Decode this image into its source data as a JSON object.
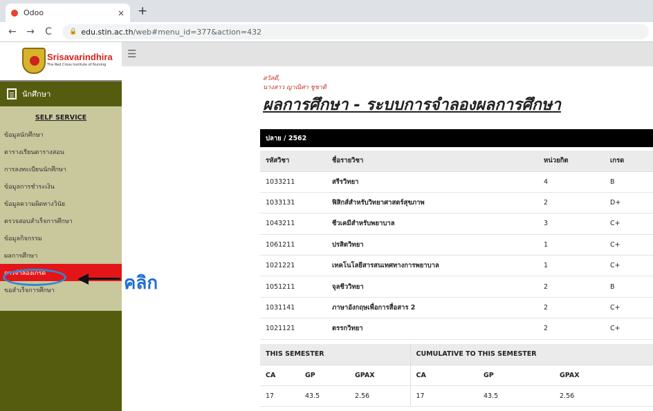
{
  "browser": {
    "tab_title": "Odoo",
    "tab_close": "×",
    "new_tab": "+",
    "nav_back": "←",
    "nav_forward": "→",
    "nav_reload": "C",
    "url_domain": "edu.stin.ac.th",
    "url_path": "/web#menu_id=377&action=432"
  },
  "sidebar": {
    "brand_name": "Srisavarindhira",
    "brand_tagline": "The Red Cross Institute of Nursing",
    "student_menu_label": "นักศึกษา",
    "self_service_heading": "SELF SERVICE",
    "items": [
      {
        "label": "ข้อมูลนักศึกษา"
      },
      {
        "label": "ตารางเรียนตารางสอน"
      },
      {
        "label": "การลงทะเบียนนักศึกษา"
      },
      {
        "label": "ข้อมูลการชำระเงิน"
      },
      {
        "label": "ข้อมูลความผิดทางวินัย"
      },
      {
        "label": "ตรวจสอบสำเร็จการศึกษา"
      },
      {
        "label": "ข้อมูลกิจกรรม"
      },
      {
        "label": "ผลการศึกษา"
      },
      {
        "label": "การจำลองเกรด"
      },
      {
        "label": "ขอสำเร็จการศึกษา"
      }
    ]
  },
  "annotation": {
    "click_label": "คลิก",
    "highlight_color": "#2b8bd6"
  },
  "topbar": {
    "menu_icon": "☰"
  },
  "main": {
    "greeting": "สวัสดี,",
    "user_name": "นางสาว ญาณิศา ชูชาติ",
    "title": "ผลการศึกษา - ระบบการจำลองผลการศึกษา",
    "semester": "ปลาย / 2562",
    "columns": [
      "รหัสวิชา",
      "ชื่อรายวิชา",
      "หน่วยกิต",
      "เกรด"
    ],
    "rows": [
      {
        "code": "1033211",
        "name": "สรีรวิทยา",
        "credit": "4",
        "grade": "B"
      },
      {
        "code": "1033131",
        "name": "ฟิสิกส์สำหรับวิทยาศาสตร์สุขภาพ",
        "credit": "2",
        "grade": "D+"
      },
      {
        "code": "1043211",
        "name": "ชีวเคมีสำหรับพยาบาล",
        "credit": "3",
        "grade": "C+"
      },
      {
        "code": "1061211",
        "name": "ปรสิตวิทยา",
        "credit": "1",
        "grade": "C+"
      },
      {
        "code": "1021221",
        "name": "เทคโนโลยีสารสนเทศทางการพยาบาล",
        "credit": "1",
        "grade": "C+"
      },
      {
        "code": "1051211",
        "name": "จุลชีววิทยา",
        "credit": "2",
        "grade": "B"
      },
      {
        "code": "1031141",
        "name": "ภาษาอังกฤษเพื่อการสื่อสาร 2",
        "credit": "2",
        "grade": "C+"
      },
      {
        "code": "1021121",
        "name": "ตรรกวิทยา",
        "credit": "2",
        "grade": "C+"
      }
    ],
    "summary": {
      "this_semester_label": "THIS SEMESTER",
      "cumulative_label": "CUMULATIVE TO THIS SEMESTER",
      "headers": [
        "CA",
        "GP",
        "GPAX",
        "CA",
        "GP",
        "GPAX"
      ],
      "values": [
        "17",
        "43.5",
        "2.56",
        "17",
        "43.5",
        "2.56"
      ]
    }
  }
}
